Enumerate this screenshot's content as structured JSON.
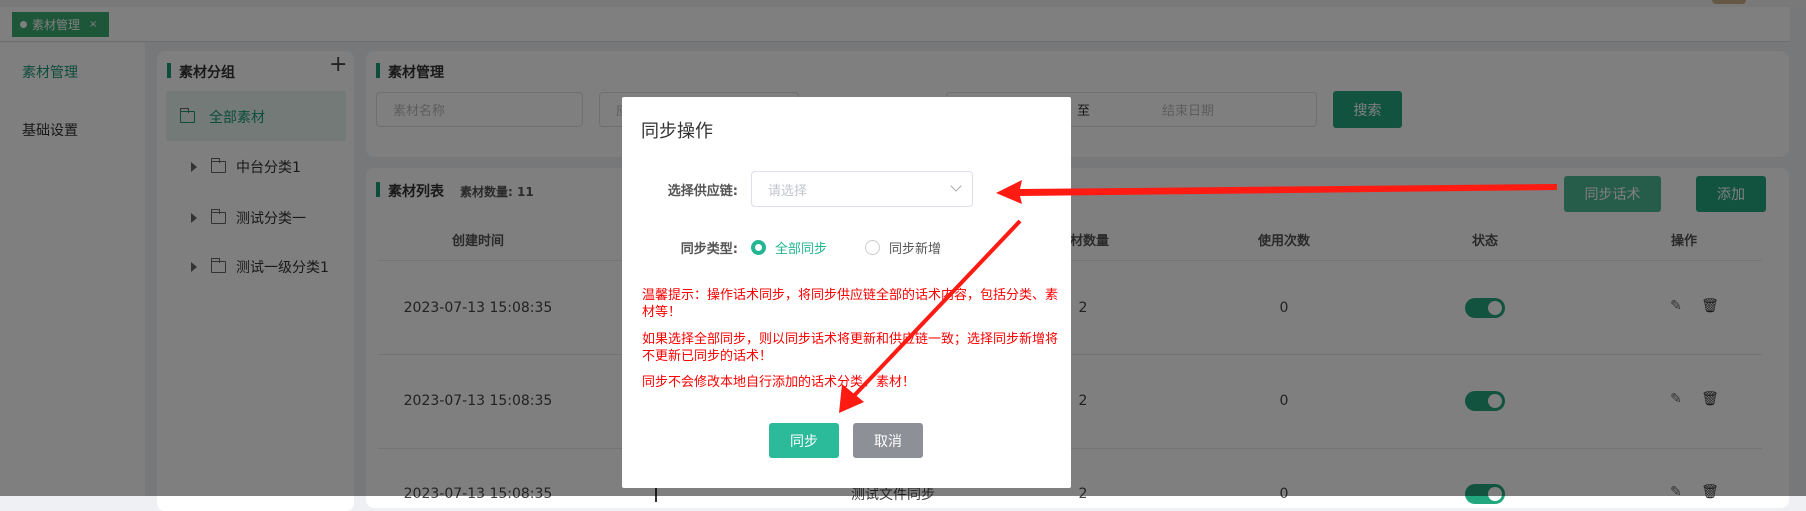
{
  "colors": {
    "accent": "#22b592",
    "warning": "#ff0000",
    "cancel": "#8e9097"
  },
  "tabs": [
    {
      "label": "素材管理",
      "close": "×"
    }
  ],
  "sidebar": {
    "items": [
      {
        "label": "素材管理",
        "active": true
      },
      {
        "label": "基础设置",
        "active": false
      }
    ]
  },
  "groups": {
    "title": "素材分组",
    "add_icon": "+",
    "items": [
      {
        "label": "全部素材",
        "selected": true
      },
      {
        "label": "中台分类1"
      },
      {
        "label": "测试分类一"
      },
      {
        "label": "测试一级分类1"
      }
    ]
  },
  "filter": {
    "title": "素材管理",
    "name_placeholder": "素材名称",
    "second_placeholder": "应",
    "range_sep": "至",
    "end_placeholder": "结束日期",
    "search_label": "搜索"
  },
  "list": {
    "title": "素材列表",
    "count_label": "素材数量: 11",
    "sync_label": "同步话术",
    "add_label": "添加",
    "columns": [
      "创建时间",
      "素材数量",
      "使用次数",
      "状态",
      "操作"
    ],
    "rows": [
      {
        "created": "2023-07-13 15:08:35",
        "count": "2",
        "uses": "0",
        "enabled": true
      },
      {
        "created": "2023-07-13 15:08:35",
        "count": "2",
        "uses": "0",
        "enabled": true
      },
      {
        "created": "2023-07-13 15:08:35",
        "name": "测试文件同步",
        "count": "2",
        "uses": "0",
        "enabled": true
      }
    ]
  },
  "modal": {
    "title": "同步操作",
    "supply_label": "选择供应链:",
    "supply_placeholder": "请选择",
    "type_label": "同步类型:",
    "options": [
      {
        "label": "全部同步",
        "checked": true
      },
      {
        "label": "同步新增",
        "checked": false
      }
    ],
    "tips": [
      "温馨提示：操作话术同步，将同步供应链全部的话术内容，包括分类、素材等！",
      "如果选择全部同步，则以同步话术将更新和供应链一致；选择同步新增将不更新已同步的话术！",
      "同步不会修改本地自行添加的话术分类、素材！"
    ],
    "confirm_label": "同步",
    "cancel_label": "取消"
  }
}
